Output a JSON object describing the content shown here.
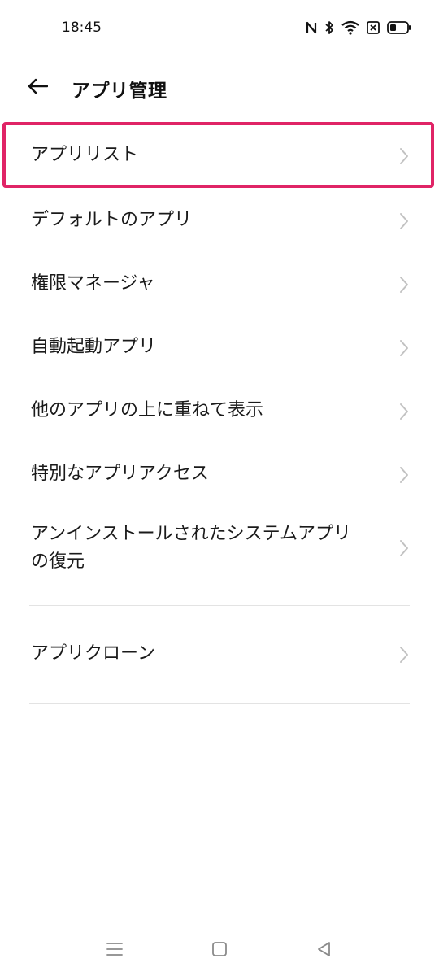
{
  "status_bar": {
    "time": "18:45",
    "icons": [
      "nfc-icon",
      "bluetooth-icon",
      "wifi-icon",
      "sim-x-icon",
      "battery-icon"
    ]
  },
  "header": {
    "title": "アプリ管理",
    "back_icon": "arrow-left-icon"
  },
  "menu": {
    "items": [
      {
        "label": "アプリリスト",
        "highlighted": true
      },
      {
        "label": "デフォルトのアプリ"
      },
      {
        "label": "権限マネージャ"
      },
      {
        "label": "自動起動アプリ"
      },
      {
        "label": "他のアプリの上に重ねて表示"
      },
      {
        "label": "特別なアプリアクセス"
      },
      {
        "label_line1": "アンインストールされたシステムアプリ",
        "label_line2": "の復元"
      }
    ],
    "section2": [
      {
        "label": "アプリクローン"
      }
    ]
  },
  "nav_bar": {
    "buttons": [
      "menu-icon",
      "home-square-icon",
      "back-triangle-icon"
    ]
  },
  "colors": {
    "highlight": "#e02466",
    "chevron": "#c2c2c2",
    "divider": "#e3e3e3"
  }
}
